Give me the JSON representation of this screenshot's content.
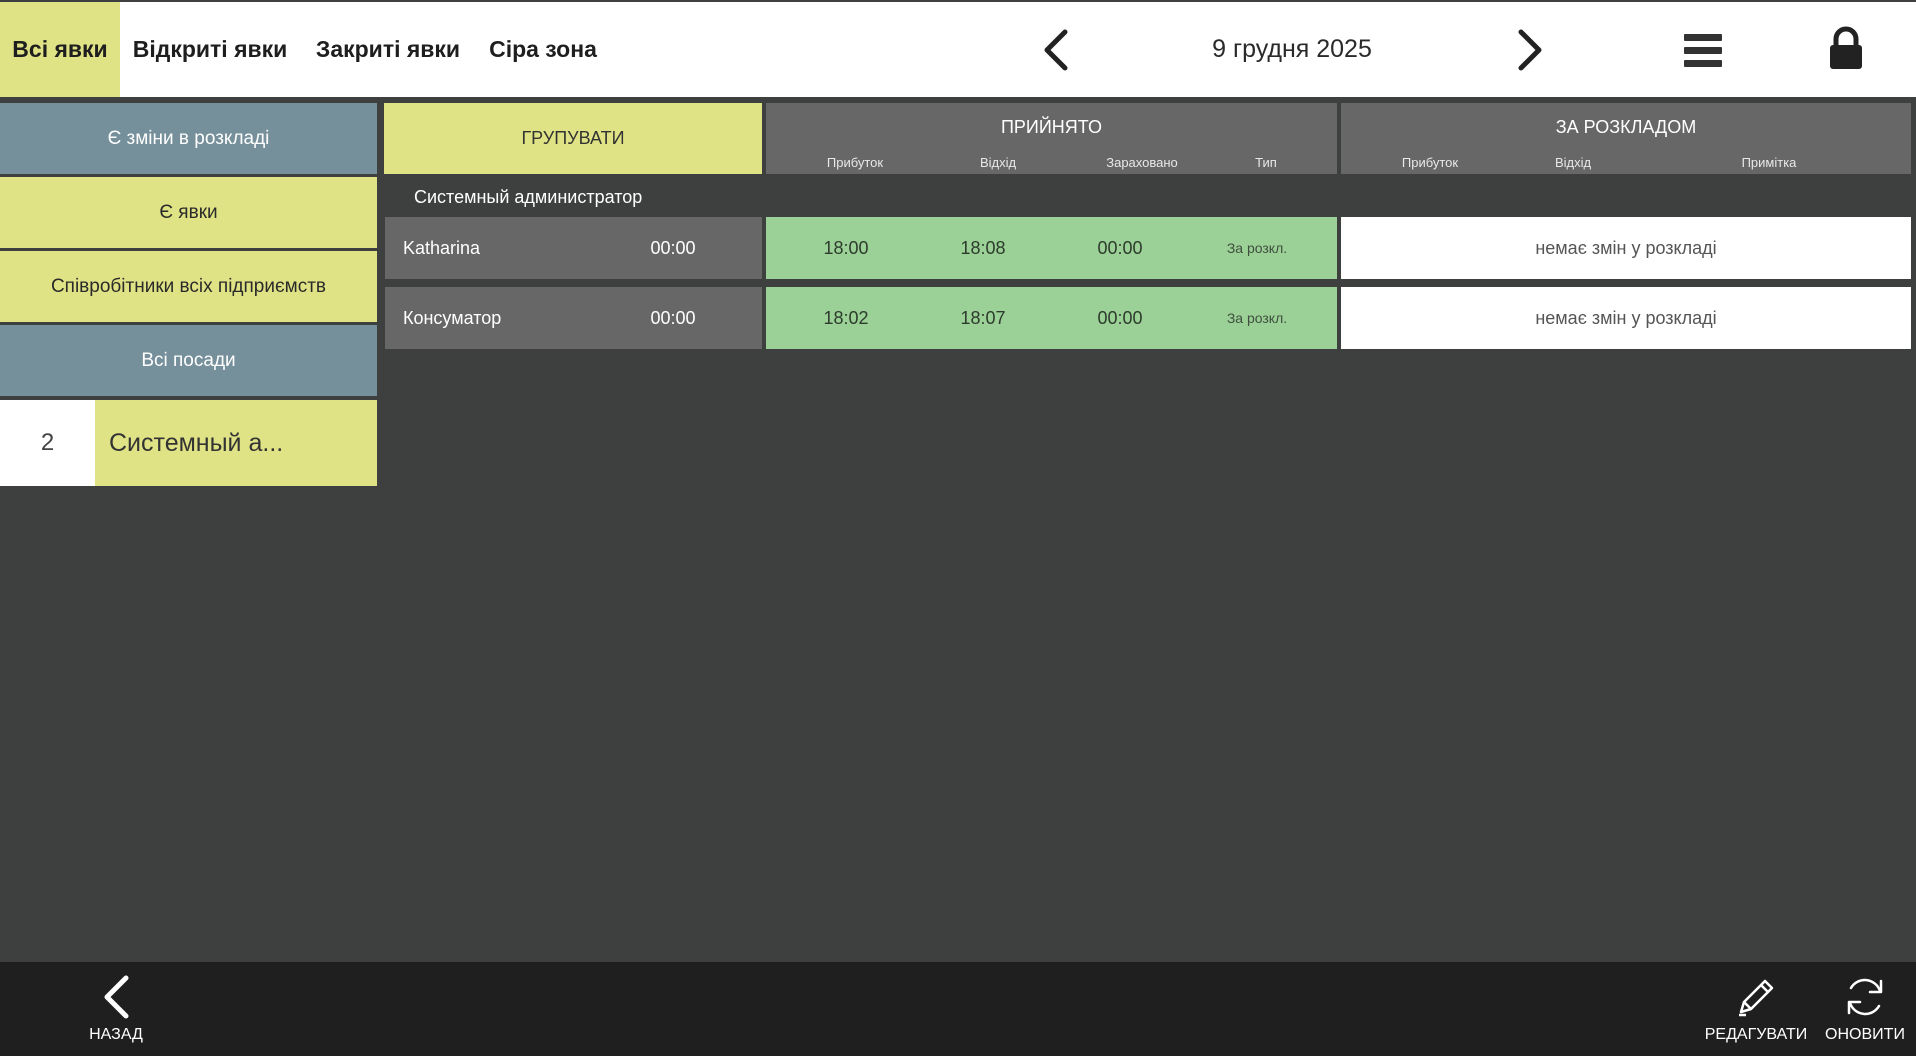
{
  "tabs": [
    {
      "label": "Всі явки",
      "active": true
    },
    {
      "label": "Відкриті явки",
      "active": false
    },
    {
      "label": "Закриті явки",
      "active": false
    },
    {
      "label": "Сіра зона",
      "active": false
    }
  ],
  "date_nav": {
    "date": "9 грудня 2025",
    "prev_icon": "chevron-left-icon",
    "next_icon": "chevron-right-icon"
  },
  "toolbar": {
    "menu_icon": "hamburger-menu-icon",
    "lock_icon": "lock-icon"
  },
  "filters": [
    {
      "label": "Є зміни в розкладі",
      "color": "#75909b"
    },
    {
      "label": "Є явки",
      "color": "#dfe385"
    },
    {
      "label": "Співробітники всіх підприємств",
      "color": "#dfe385"
    },
    {
      "label": "Всі посади",
      "color": "#75909b"
    }
  ],
  "group_list": [
    {
      "count": "2",
      "name": "Системный а..."
    }
  ],
  "table": {
    "group_button": "ГРУПУВАТИ",
    "accepted": {
      "title": "ПРИЙНЯТО",
      "columns": [
        "Прибуток",
        "Відхід",
        "Зараховано",
        "Тип"
      ]
    },
    "scheduled": {
      "title": "ЗА РОЗКЛАДОМ",
      "columns": [
        "Прибуток",
        "Відхід",
        "Примітка"
      ]
    },
    "section": "Системный администратор",
    "rows": [
      {
        "name": "Katharina",
        "total": "00:00",
        "arrival": "18:00",
        "departure": "18:08",
        "credited": "00:00",
        "type": "За розкл.",
        "schedule_note": "немає змін у розкладі"
      },
      {
        "name": "Консуматор",
        "total": "00:00",
        "arrival": "18:02",
        "departure": "18:07",
        "credited": "00:00",
        "type": "За розкл.",
        "schedule_note": "немає змін у розкладі"
      }
    ]
  },
  "bottom": {
    "back": "НАЗАД",
    "edit": "РЕДАГУВАТИ",
    "refresh": "ОНОВИТИ"
  },
  "colors": {
    "background": "#3e403f",
    "accent_yellow": "#dfe385",
    "filter_blue": "#75909b",
    "accepted_green": "#9bd196",
    "header_grey": "#676767",
    "bottom_bar": "#1f1f1f"
  }
}
